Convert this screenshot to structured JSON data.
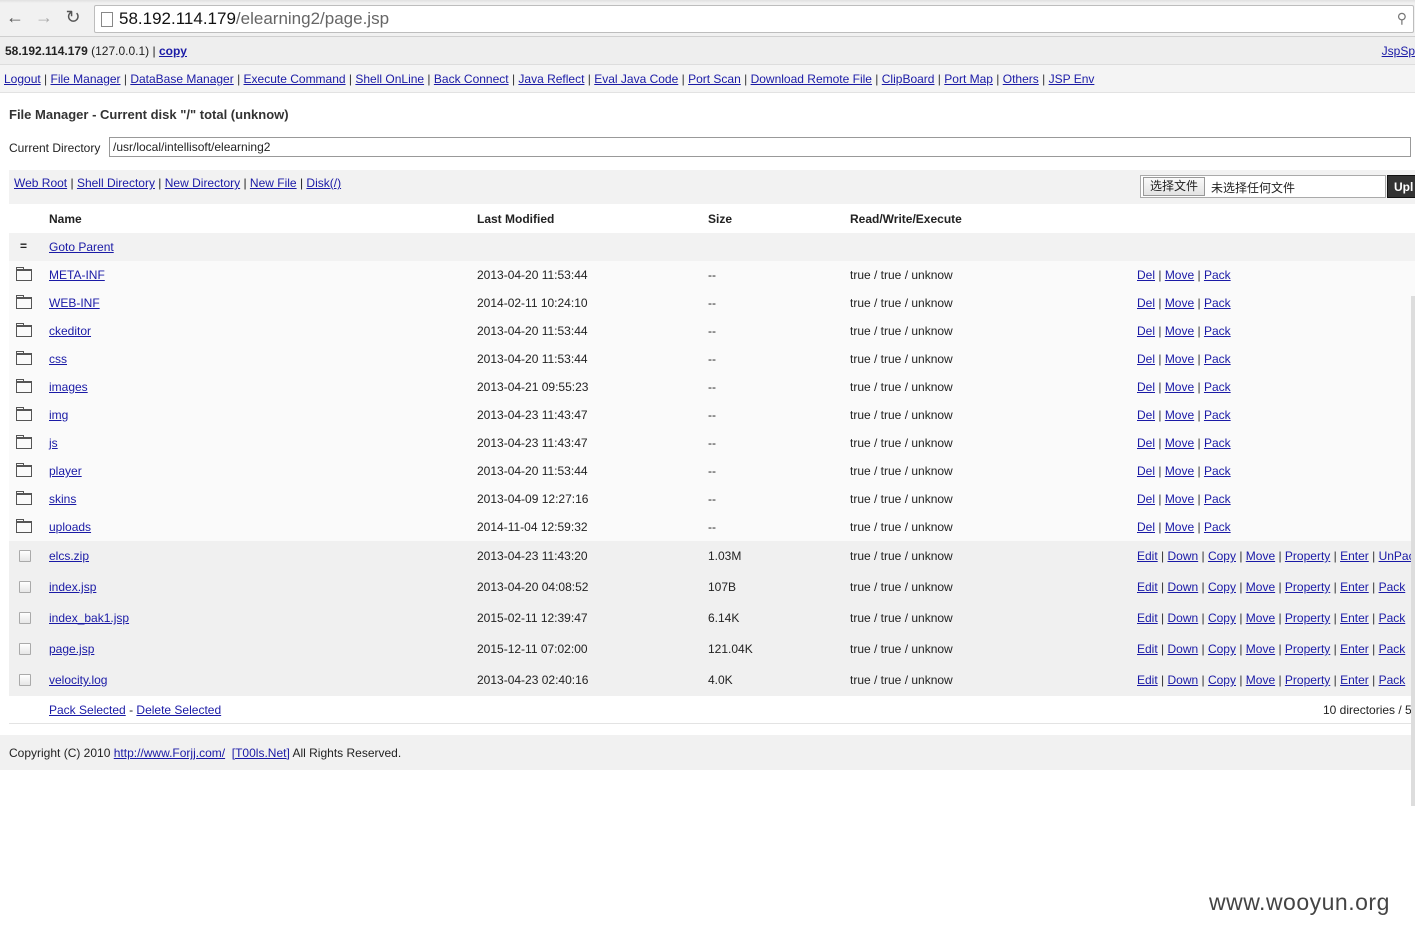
{
  "browser": {
    "url_host": "58.192.114.179",
    "url_path": "/elearning2/page.jsp"
  },
  "info": {
    "host": "58.192.114.179",
    "local": "(127.0.0.1)",
    "copy": "copy",
    "right_link": "JspSp"
  },
  "menu": [
    "Logout",
    "File Manager",
    "DataBase Manager",
    "Execute Command",
    "Shell OnLine",
    "Back Connect",
    "Java Reflect",
    "Eval Java Code",
    "Port Scan",
    "Download Remote File",
    "ClipBoard",
    "Port Map",
    "Others",
    "JSP Env"
  ],
  "page_title": "File Manager - Current disk \"/\" total (unknow)",
  "current_dir": {
    "label": "Current Directory",
    "value": "/usr/local/intellisoft/elearning2"
  },
  "toolbar": {
    "links": [
      "Web Root",
      "Shell Directory",
      "New Directory",
      "New File",
      "Disk(/)"
    ],
    "choose_file": "选择文件",
    "no_file": "未选择任何文件",
    "upload": "Upl"
  },
  "headers": {
    "name": "Name",
    "modified": "Last Modified",
    "size": "Size",
    "rwx": "Read/Write/Execute"
  },
  "parent": {
    "icon": "=",
    "label": "Goto Parent"
  },
  "dirs": [
    {
      "name": "META-INF",
      "modified": "2013-04-20 11:53:44",
      "size": "--",
      "rwx": "true / true / unknow"
    },
    {
      "name": "WEB-INF",
      "modified": "2014-02-11 10:24:10",
      "size": "--",
      "rwx": "true / true / unknow"
    },
    {
      "name": "ckeditor",
      "modified": "2013-04-20 11:53:44",
      "size": "--",
      "rwx": "true / true / unknow"
    },
    {
      "name": "css",
      "modified": "2013-04-20 11:53:44",
      "size": "--",
      "rwx": "true / true / unknow"
    },
    {
      "name": "images",
      "modified": "2013-04-21 09:55:23",
      "size": "--",
      "rwx": "true / true / unknow"
    },
    {
      "name": "img",
      "modified": "2013-04-23 11:43:47",
      "size": "--",
      "rwx": "true / true / unknow"
    },
    {
      "name": "js",
      "modified": "2013-04-23 11:43:47",
      "size": "--",
      "rwx": "true / true / unknow"
    },
    {
      "name": "player",
      "modified": "2013-04-20 11:53:44",
      "size": "--",
      "rwx": "true / true / unknow"
    },
    {
      "name": "skins",
      "modified": "2013-04-09 12:27:16",
      "size": "--",
      "rwx": "true / true / unknow"
    },
    {
      "name": "uploads",
      "modified": "2014-11-04 12:59:32",
      "size": "--",
      "rwx": "true / true / unknow"
    }
  ],
  "dir_actions": [
    "Del",
    "Move",
    "Pack"
  ],
  "files": [
    {
      "name": "elcs.zip",
      "modified": "2013-04-23 11:43:20",
      "size": "1.03M",
      "rwx": "true / true / unknow",
      "actions": [
        "Edit",
        "Down",
        "Copy",
        "Move",
        "Property",
        "Enter",
        "UnPac"
      ]
    },
    {
      "name": "index.jsp",
      "modified": "2013-04-20 04:08:52",
      "size": "107B",
      "rwx": "true / true / unknow",
      "actions": [
        "Edit",
        "Down",
        "Copy",
        "Move",
        "Property",
        "Enter",
        "Pack"
      ]
    },
    {
      "name": "index_bak1.jsp",
      "modified": "2015-02-11 12:39:47",
      "size": "6.14K",
      "rwx": "true / true / unknow",
      "actions": [
        "Edit",
        "Down",
        "Copy",
        "Move",
        "Property",
        "Enter",
        "Pack"
      ]
    },
    {
      "name": "page.jsp",
      "modified": "2015-12-11 07:02:00",
      "size": "121.04K",
      "rwx": "true / true / unknow",
      "actions": [
        "Edit",
        "Down",
        "Copy",
        "Move",
        "Property",
        "Enter",
        "Pack"
      ]
    },
    {
      "name": "velocity.log",
      "modified": "2013-04-23 02:40:16",
      "size": "4.0K",
      "rwx": "true / true / unknow",
      "actions": [
        "Edit",
        "Down",
        "Copy",
        "Move",
        "Property",
        "Enter",
        "Pack"
      ]
    }
  ],
  "footer": {
    "pack_selected": "Pack Selected",
    "sep": "-",
    "delete_selected": "Delete Selected",
    "summary": "10 directories / 5"
  },
  "copyright": {
    "prefix": "Copyright (C) 2010",
    "link1": "http://www.Forjj.com/",
    "link2": "[T00ls.Net]",
    "suffix": "All Rights Reserved."
  },
  "watermark": "www.wooyun.org"
}
